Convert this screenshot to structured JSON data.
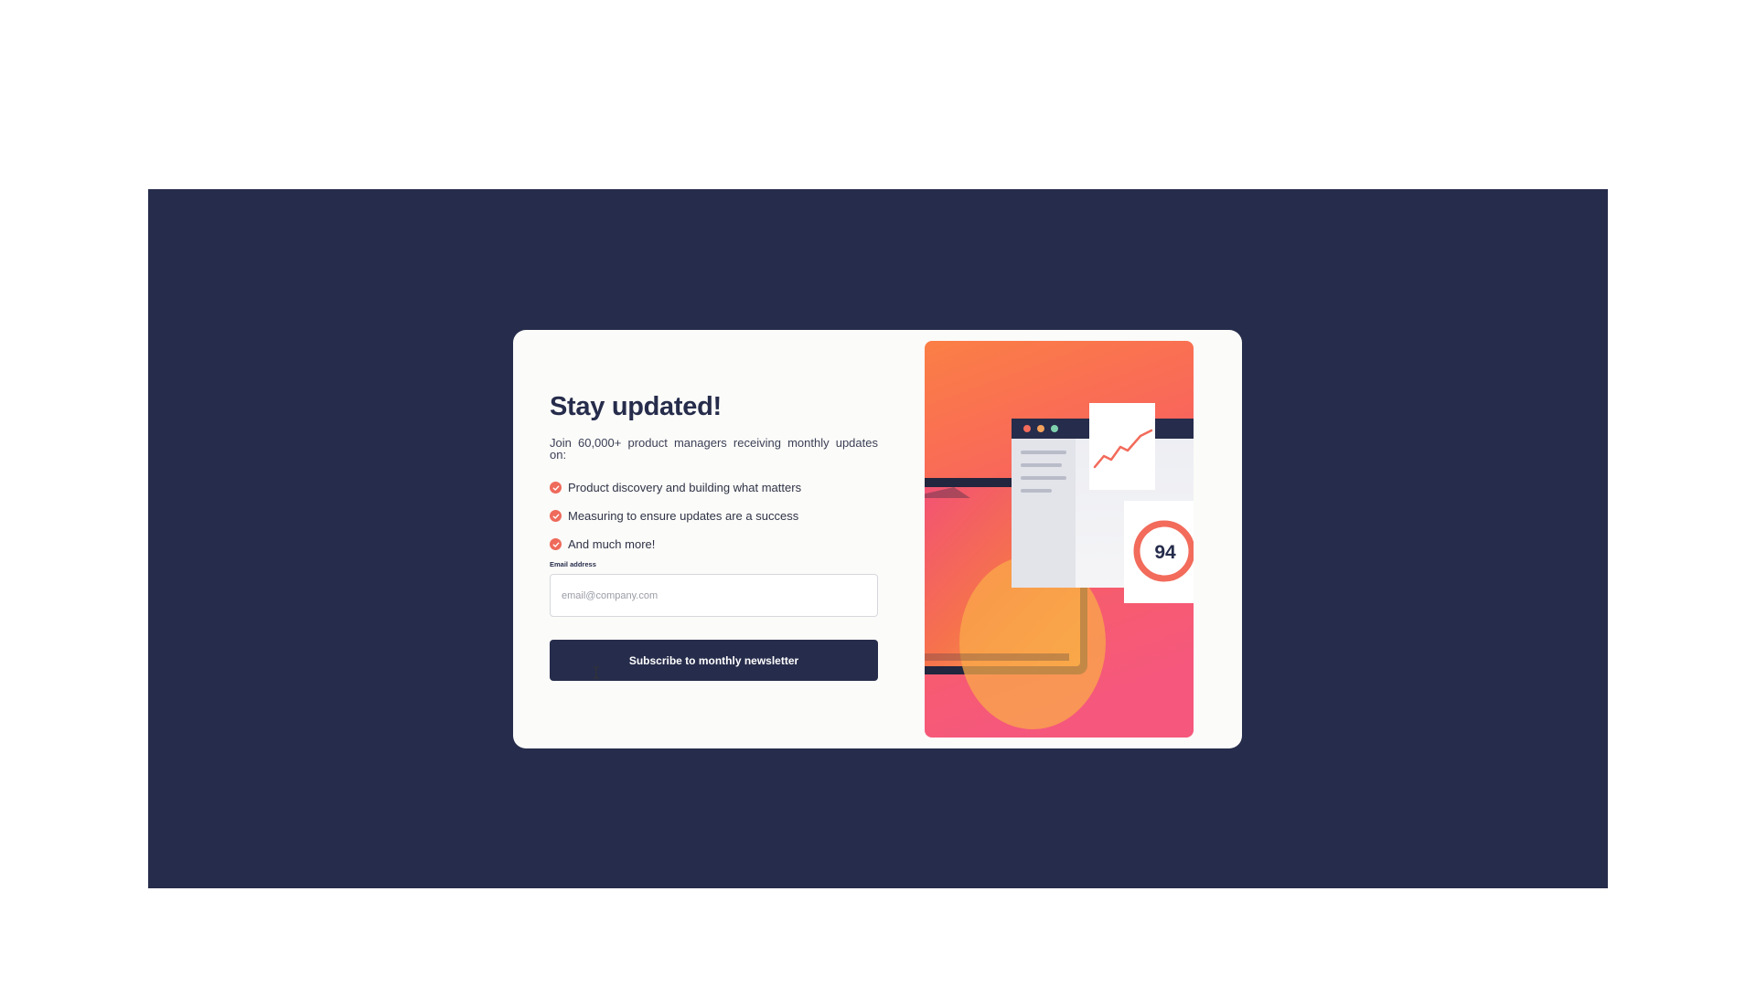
{
  "newsletter": {
    "title": "Stay updated!",
    "intro": "Join 60,000+ product managers receiving monthly updates on:",
    "bullets": [
      "Product discovery and building what matters",
      "Measuring to ensure updates are a success",
      "And much more!"
    ],
    "email_label": "Email address",
    "email_placeholder": "email@company.com",
    "email_value": "",
    "subscribe_label": "Subscribe to monthly newsletter"
  },
  "illustration": {
    "score": "94",
    "window_dots": [
      "#f26b5b",
      "#f5a25d",
      "#7fd1ae"
    ]
  },
  "colors": {
    "background": "#262c4b",
    "card": "#fbfbf9",
    "accent": "#ee6a5b",
    "button": "#262c4b"
  }
}
